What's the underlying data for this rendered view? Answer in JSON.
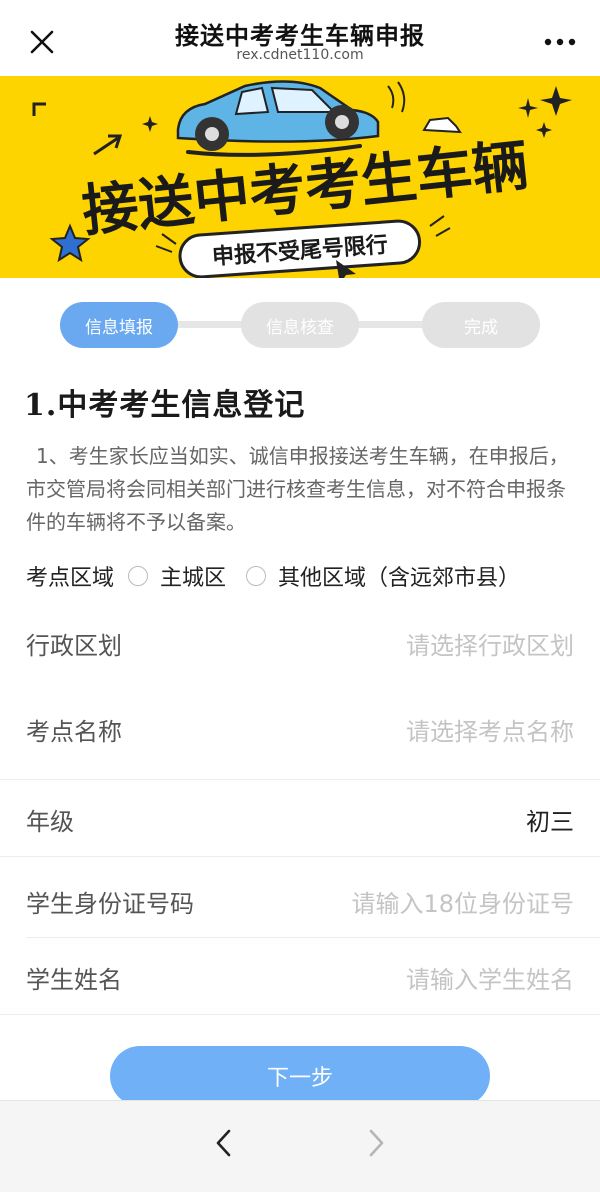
{
  "header": {
    "title": "接送中考考生车辆申报",
    "url": "rex.cdnet110.com"
  },
  "banner": {
    "headline": "接送中考考生车辆",
    "subline": "申报不受尾号限行"
  },
  "steps": [
    {
      "label": "信息填报",
      "active": true
    },
    {
      "label": "信息核查",
      "active": false
    },
    {
      "label": "完成",
      "active": false
    }
  ],
  "section_title": "1.中考考生信息登记",
  "notice": "1、考生家长应当如实、诚信申报接送考生车辆，在申报后，市交管局将会同相关部门进行核查考生信息，对不符合申报条件的车辆将不予以备案。",
  "region": {
    "label": "考点区域",
    "options": [
      "主城区",
      "其他区域（含远郊市县）"
    ]
  },
  "fields": {
    "district": {
      "label": "行政区划",
      "placeholder": "请选择行政区划"
    },
    "exam_site": {
      "label": "考点名称",
      "placeholder": "请选择考点名称"
    },
    "grade": {
      "label": "年级",
      "value": "初三"
    },
    "id_number": {
      "label": "学生身份证号码",
      "placeholder": "请输入18位身份证号"
    },
    "student_name": {
      "label": "学生姓名",
      "placeholder": "请输入学生姓名"
    }
  },
  "next_button": "下一步",
  "colors": {
    "accent": "#6aa9f0",
    "banner_bg": "#fdd300",
    "placeholder": "#c4c4c4"
  }
}
